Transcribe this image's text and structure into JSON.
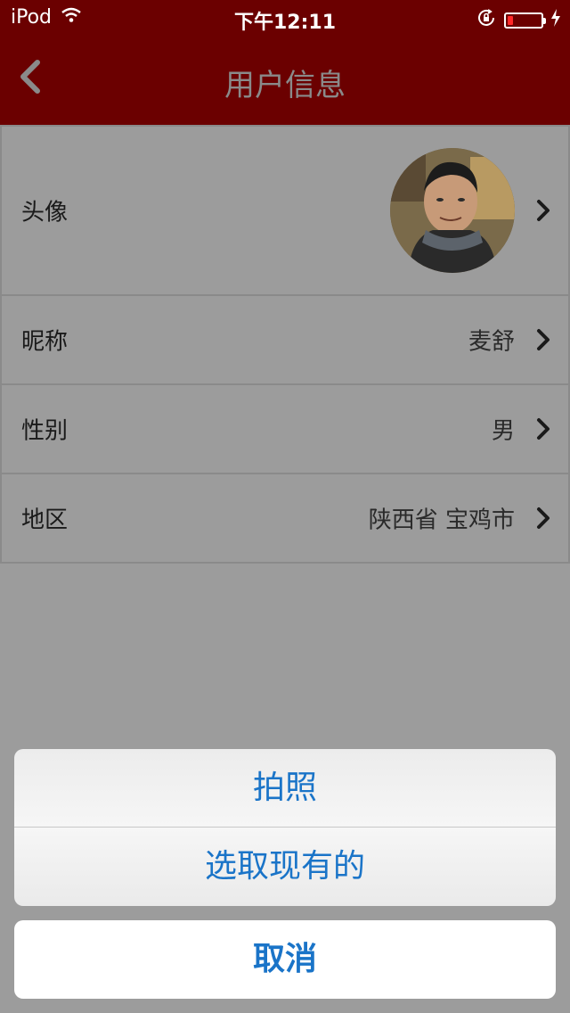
{
  "status_bar": {
    "carrier": "iPod",
    "time": "下午12:11",
    "battery_level": 0.18
  },
  "nav": {
    "title": "用户信息"
  },
  "rows": [
    {
      "label": "头像",
      "value": ""
    },
    {
      "label": "昵称",
      "value": "麦舒"
    },
    {
      "label": "性别",
      "value": "男"
    },
    {
      "label": "地区",
      "value": "陕西省 宝鸡市"
    }
  ],
  "action_sheet": {
    "take_photo": "拍照",
    "choose_existing": "选取现有的",
    "cancel": "取消"
  },
  "colors": {
    "nav_bg": "#6b0000",
    "action_text": "#1a74c8",
    "dim_bg": "#9c9c9c"
  }
}
